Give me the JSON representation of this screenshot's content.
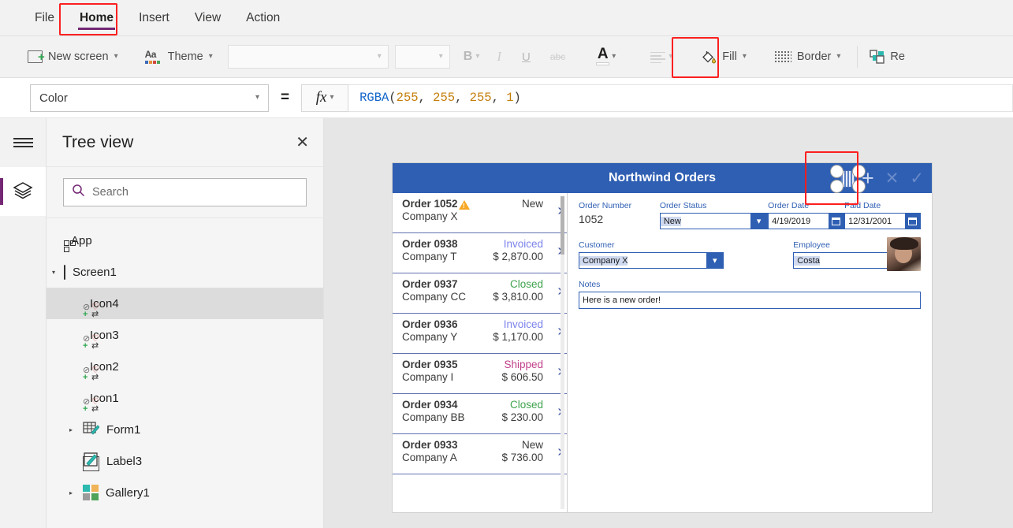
{
  "menu": {
    "items": [
      {
        "label": "File",
        "active": false
      },
      {
        "label": "Home",
        "active": true
      },
      {
        "label": "Insert",
        "active": false
      },
      {
        "label": "View",
        "active": false
      },
      {
        "label": "Action",
        "active": false
      }
    ]
  },
  "ribbon": {
    "new_screen": "New screen",
    "theme": "Theme",
    "font_family_value": "",
    "font_size_value": "",
    "bold": "B",
    "italic": "I",
    "underline": "U",
    "strikethrough": "abc",
    "font_color": "A",
    "fill": "Fill",
    "border": "Border",
    "reorder": "Re"
  },
  "formula_bar": {
    "property": "Color",
    "equals": "=",
    "fx": "fx",
    "formula_tokens": [
      {
        "text": "RGBA",
        "type": "fn"
      },
      {
        "text": "(",
        "type": "pn"
      },
      {
        "text": "255",
        "type": "num"
      },
      {
        "text": ", ",
        "type": "pn"
      },
      {
        "text": "255",
        "type": "num"
      },
      {
        "text": ", ",
        "type": "pn"
      },
      {
        "text": "255",
        "type": "num"
      },
      {
        "text": ", ",
        "type": "pn"
      },
      {
        "text": "1",
        "type": "num"
      },
      {
        "text": ")",
        "type": "pn"
      }
    ],
    "formula_text": "RGBA(255, 255, 255, 1)"
  },
  "tree_view": {
    "title": "Tree view",
    "search_placeholder": "Search",
    "nodes": [
      {
        "label": "App",
        "glyph": "app",
        "depth": 0,
        "twisty": "none",
        "selected": false
      },
      {
        "label": "Screen1",
        "glyph": "screen",
        "depth": 0,
        "twisty": "expanded",
        "selected": false
      },
      {
        "label": "Icon4",
        "glyph": "icon",
        "depth": 1,
        "twisty": "none",
        "selected": true
      },
      {
        "label": "Icon3",
        "glyph": "icon",
        "depth": 1,
        "twisty": "none",
        "selected": false
      },
      {
        "label": "Icon2",
        "glyph": "icon",
        "depth": 1,
        "twisty": "none",
        "selected": false
      },
      {
        "label": "Icon1",
        "glyph": "icon",
        "depth": 1,
        "twisty": "none",
        "selected": false
      },
      {
        "label": "Form1",
        "glyph": "form",
        "depth": 1,
        "twisty": "collapsed",
        "selected": false
      },
      {
        "label": "Label3",
        "glyph": "label",
        "depth": 1,
        "twisty": "none",
        "selected": false
      },
      {
        "label": "Gallery1",
        "glyph": "gallery",
        "depth": 1,
        "twisty": "collapsed",
        "selected": false
      }
    ]
  },
  "app_preview": {
    "header_title": "Northwind Orders",
    "header_icons": {
      "add": "+",
      "cancel": "✕",
      "confirm": "✓"
    },
    "orders": [
      {
        "order": "Order 1052",
        "company": "Company X",
        "status": "New",
        "amount": "",
        "warning": true,
        "status_color": "#3b3a39"
      },
      {
        "order": "Order 0938",
        "company": "Company T",
        "status": "Invoiced",
        "amount": "$ 2,870.00",
        "warning": false,
        "status_color": "#7b83eb"
      },
      {
        "order": "Order 0937",
        "company": "Company CC",
        "status": "Closed",
        "amount": "$ 3,810.00",
        "warning": false,
        "status_color": "#3fa34d"
      },
      {
        "order": "Order 0936",
        "company": "Company Y",
        "status": "Invoiced",
        "amount": "$ 1,170.00",
        "warning": false,
        "status_color": "#7b83eb"
      },
      {
        "order": "Order 0935",
        "company": "Company I",
        "status": "Shipped",
        "amount": "$ 606.50",
        "warning": false,
        "status_color": "#c2408a"
      },
      {
        "order": "Order 0934",
        "company": "Company BB",
        "status": "Closed",
        "amount": "$ 230.00",
        "warning": false,
        "status_color": "#3fa34d"
      },
      {
        "order": "Order 0933",
        "company": "Company A",
        "status": "New",
        "amount": "$ 736.00",
        "warning": false,
        "status_color": "#3b3a39"
      }
    ],
    "form": {
      "order_number_label": "Order Number",
      "order_number_value": "1052",
      "order_status_label": "Order Status",
      "order_status_value": "New",
      "order_date_label": "Order Date",
      "order_date_value": "4/19/2019",
      "paid_date_label": "Paid Date",
      "paid_date_value": "12/31/2001",
      "customer_label": "Customer",
      "customer_value": "Company X",
      "employee_label": "Employee",
      "employee_value": "Costa",
      "notes_label": "Notes",
      "notes_value": "Here is a new order!"
    }
  },
  "colors": {
    "accent_purple": "#742774",
    "highlight_red": "#fc1f1f",
    "app_header_blue": "#2f5fb3",
    "field_blue": "#2f5fb3",
    "warning_amber": "#f7a724"
  }
}
